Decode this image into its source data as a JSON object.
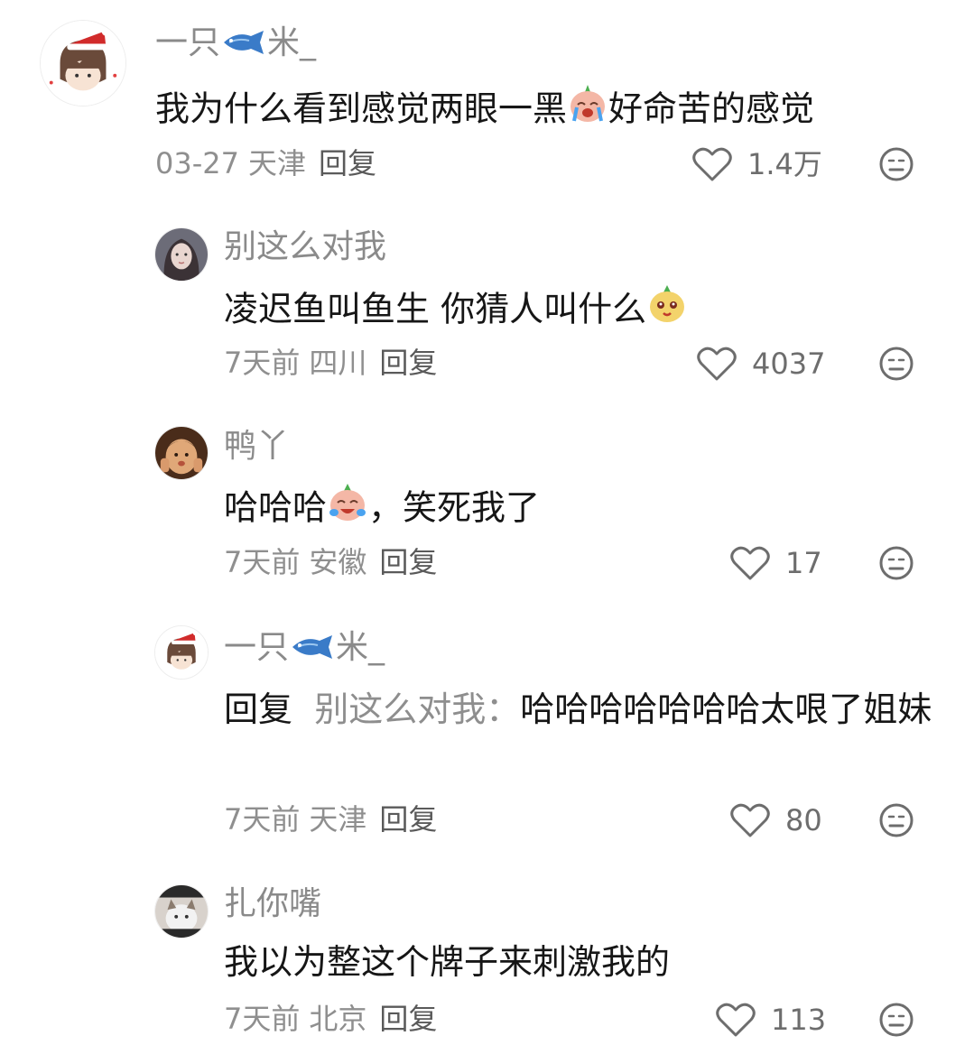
{
  "comments": [
    {
      "username_part1": "一只",
      "username_part2": "米_",
      "text_part1": "我为什么看到感觉两眼一黑",
      "text_part2": "好命苦的感觉",
      "time": "03-27",
      "location": "天津",
      "reply_label": "回复",
      "likes": "1.4万",
      "emoji": "crying-radish-emoji"
    },
    {
      "username": "别这么对我",
      "text": "凌迟鱼叫鱼生 你猜人叫什么",
      "time": "7天前",
      "location": "四川",
      "reply_label": "回复",
      "likes": "4037",
      "emoji": "smiling-radish-emoji"
    },
    {
      "username": "鸭丫",
      "text_part1": "哈哈哈",
      "text_part2": "，笑死我了",
      "time": "7天前",
      "location": "安徽",
      "reply_label": "回复",
      "likes": "17",
      "emoji": "laughing-radish-emoji"
    },
    {
      "username_part1": "一只",
      "username_part2": "米_",
      "reply_prefix": "回复",
      "reply_target": "别这么对我：",
      "text": "哈哈哈哈哈哈哈太哏了姐妹",
      "time": "7天前",
      "location": "天津",
      "reply_label": "回复",
      "likes": "80"
    },
    {
      "username": "扎你嘴",
      "text": "我以为整这个牌子来刺激我的",
      "time": "7天前",
      "location": "北京",
      "reply_label": "回复",
      "likes": "113"
    }
  ],
  "icons": {
    "like": "heart-outline-icon",
    "dislike": "neutral-face-icon",
    "fish": "fish-emoji"
  },
  "colors": {
    "text": "#161616",
    "muted": "#8f8f8f",
    "username": "#8a8a8a",
    "reply_button": "#5a5a5a"
  }
}
